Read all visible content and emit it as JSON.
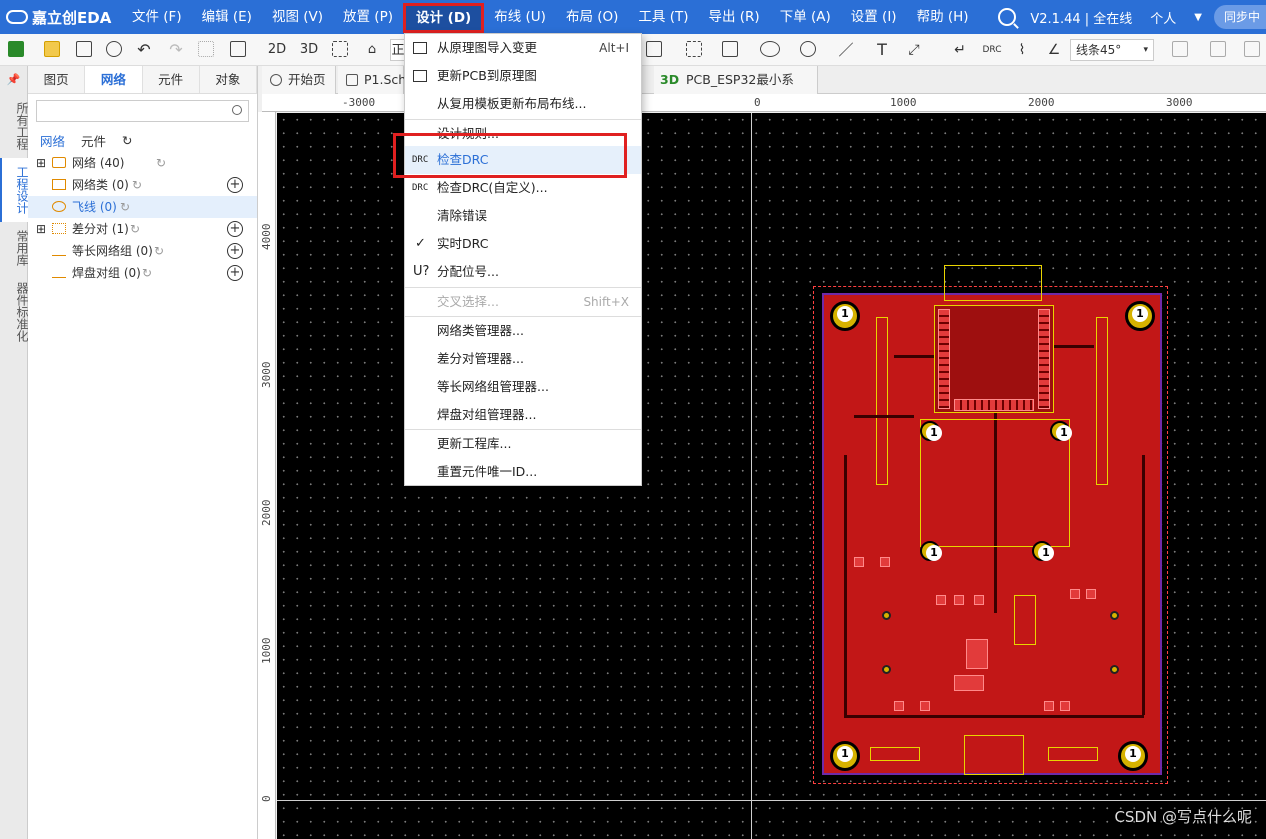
{
  "app": {
    "logo": "嘉立创EDA",
    "version": "V2.1.44 | 全在线",
    "user": "个人",
    "sync": "同步中"
  },
  "menubar": [
    "文件 (F)",
    "编辑 (E)",
    "视图 (V)",
    "放置 (P)",
    "设计 (D)",
    "布线 (U)",
    "布局 (O)",
    "工具 (T)",
    "导出 (R)",
    "下单 (A)",
    "设置 (I)",
    "帮助 (H)"
  ],
  "toolbar": {
    "view2d": "2D",
    "view3d": "3D",
    "layer_value": "线条45°",
    "truncated_label": "正"
  },
  "vertical_tabs": [
    "所有工程",
    "工程设计",
    "常用库",
    "器件标准化"
  ],
  "panel": {
    "tabs": [
      "图页",
      "网络",
      "元件",
      "对象"
    ],
    "search_placeholder": "",
    "sub_tabs": [
      "网络",
      "元件"
    ],
    "tree": [
      {
        "label": "网络 (40)"
      },
      {
        "label": "网络类 (0)"
      },
      {
        "label": "飞线 (0)"
      },
      {
        "label": "差分对 (1)"
      },
      {
        "label": "等长网络组 (0)"
      },
      {
        "label": "焊盘对组 (0)"
      }
    ]
  },
  "doc_tabs": [
    "开始页",
    "P1.Sch",
    "PCB_ESP32最小系"
  ],
  "ruler_h": [
    "-3000",
    "0",
    "1000",
    "2000",
    "3000"
  ],
  "ruler_v": [
    "4000",
    "3000",
    "2000",
    "1000",
    "0"
  ],
  "dropdown": {
    "items": [
      {
        "label": "从原理图导入变更",
        "shortcut": "Alt+I"
      },
      {
        "label": "更新PCB到原理图",
        "shortcut": ""
      },
      {
        "label": "从复用模板更新布局布线...",
        "shortcut": ""
      },
      {
        "label": "设计规则...",
        "shortcut": ""
      },
      {
        "label": "检查DRC",
        "shortcut": ""
      },
      {
        "label": "检查DRC(自定义)...",
        "shortcut": ""
      },
      {
        "label": "清除错误",
        "shortcut": ""
      },
      {
        "label": "实时DRC",
        "shortcut": ""
      },
      {
        "label": "分配位号...",
        "shortcut": ""
      },
      {
        "label": "交叉选择...",
        "shortcut": "Shift+X"
      },
      {
        "label": "网络类管理器...",
        "shortcut": ""
      },
      {
        "label": "差分对管理器...",
        "shortcut": ""
      },
      {
        "label": "等长网络组管理器...",
        "shortcut": ""
      },
      {
        "label": "焊盘对组管理器...",
        "shortcut": ""
      },
      {
        "label": "更新工程库...",
        "shortcut": ""
      },
      {
        "label": "重置元件唯一ID...",
        "shortcut": ""
      }
    ],
    "drc_tag": "DRC"
  },
  "watermark": "CSDN @写点什么呢",
  "colors": {
    "menubar": "#2b6fd6",
    "board": "#c21717",
    "highlight": "#e02020",
    "silkscreen": "#e9d400"
  }
}
